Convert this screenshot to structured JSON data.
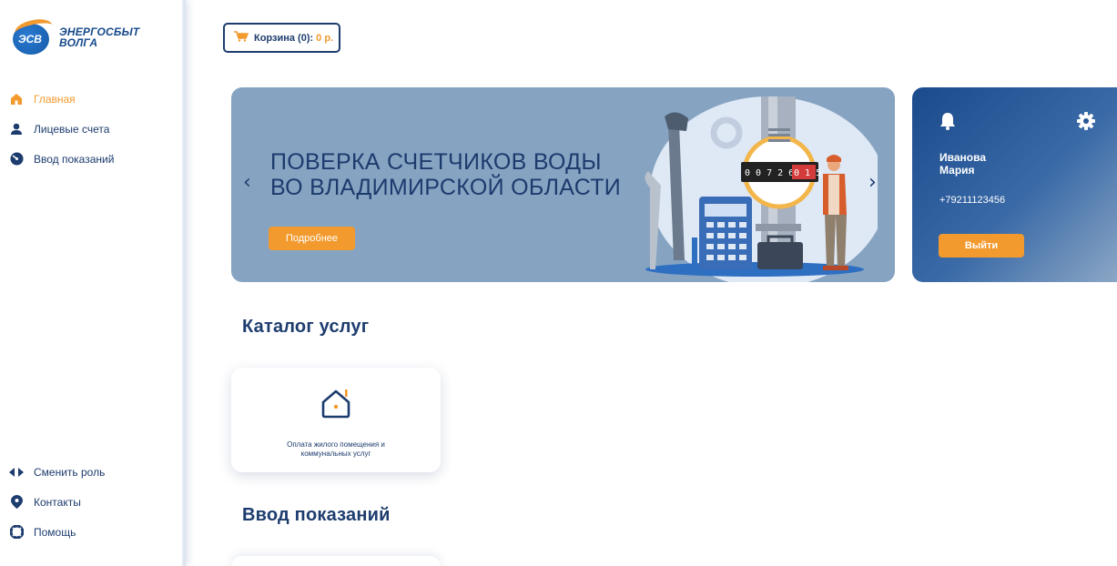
{
  "logo": {
    "abbr": "ЭСВ",
    "line1": "ЭНЕРГОСБЫТ",
    "line2": "ВОЛГА"
  },
  "sidebar": {
    "items": [
      {
        "label": "Главная",
        "icon": "home-icon",
        "active": true
      },
      {
        "label": "Лицевые счета",
        "icon": "user-icon",
        "active": false
      },
      {
        "label": "Ввод показаний",
        "icon": "gauge-icon",
        "active": false
      }
    ],
    "bottom": [
      {
        "label": "Сменить роль",
        "icon": "switch-role-icon"
      },
      {
        "label": "Контакты",
        "icon": "location-pin-icon"
      },
      {
        "label": "Помощь",
        "icon": "lifebuoy-icon"
      }
    ]
  },
  "cart": {
    "label": "Корзина (0):",
    "price": "0 р.",
    "icon": "cart-icon"
  },
  "banner": {
    "title_line1": "ПОВЕРКА СЧЕТЧИКОВ ВОДЫ",
    "title_line2": "ВО ВЛАДИМИРСКОЙ ОБЛАСТИ",
    "button": "Подробнее",
    "prev": "‹",
    "next": "›",
    "meter_digits": "0 0 7 2 6 0 1 5",
    "background": "#86a4c2"
  },
  "profile": {
    "first_line": "Иванова",
    "second_line": "Мария",
    "phone": "+79211123456",
    "logout": "Выйти"
  },
  "catalog": {
    "title": "Каталог услуг",
    "cards": [
      {
        "label_line1": "Оплата жилого помещения и",
        "label_line2": "коммунальных услуг",
        "icon": "house-icon"
      }
    ]
  },
  "readings": {
    "title": "Ввод показаний"
  },
  "colors": {
    "accent": "#f39a2e",
    "primary": "#1d3c6e"
  }
}
